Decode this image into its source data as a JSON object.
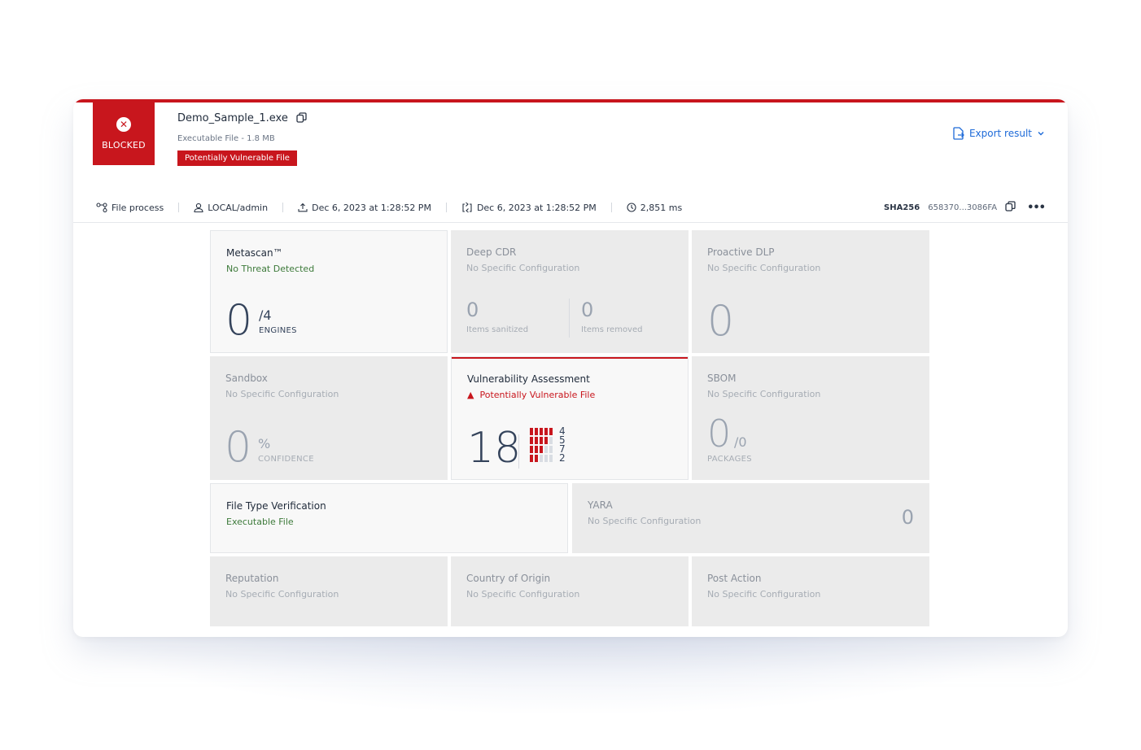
{
  "status": {
    "label": "BLOCKED",
    "color": "#c8161d"
  },
  "file": {
    "name": "Demo_Sample_1.exe",
    "subtitle": "Executable File - 1.8 MB",
    "badge": "Potentially Vulnerable File"
  },
  "header": {
    "export_label": "Export result"
  },
  "meta": {
    "process": "File process",
    "user": "LOCAL/admin",
    "uploaded": "Dec 6, 2023 at 1:28:52 PM",
    "processed": "Dec 6, 2023 at 1:28:52 PM",
    "duration": "2,851 ms",
    "sha_label": "SHA256",
    "sha_value": "658370...3086FA"
  },
  "tiles": {
    "metascan": {
      "title": "Metascan™",
      "status": "No Threat Detected",
      "value": "0",
      "total": "/4",
      "unit": "ENGINES"
    },
    "deep_cdr": {
      "title": "Deep CDR",
      "status": "No Specific Configuration",
      "sanitized": "0",
      "sanitized_label": "Items sanitized",
      "removed": "0",
      "removed_label": "Items removed"
    },
    "dlp": {
      "title": "Proactive DLP",
      "status": "No Specific Configuration",
      "value": "0"
    },
    "sandbox": {
      "title": "Sandbox",
      "status": "No Specific Configuration",
      "value": "0",
      "pct": "%",
      "unit": "CONFIDENCE"
    },
    "vuln": {
      "title": "Vulnerability Assessment",
      "status": "Potentially Vulnerable File",
      "value": "18",
      "severity": [
        {
          "level": 5,
          "count": "4"
        },
        {
          "level": 4,
          "count": "5"
        },
        {
          "level": 3,
          "count": "7"
        },
        {
          "level": 2,
          "count": "2"
        }
      ]
    },
    "sbom": {
      "title": "SBOM",
      "status": "No Specific Configuration",
      "value": "0",
      "total": "/0",
      "unit": "PACKAGES"
    },
    "filetype": {
      "title": "File Type Verification",
      "status": "Executable File"
    },
    "yara": {
      "title": "YARA",
      "status": "No Specific Configuration",
      "value": "0"
    },
    "reputation": {
      "title": "Reputation",
      "status": "No Specific Configuration"
    },
    "country": {
      "title": "Country of Origin",
      "status": "No Specific Configuration"
    },
    "post_action": {
      "title": "Post Action",
      "status": "No Specific Configuration"
    }
  }
}
